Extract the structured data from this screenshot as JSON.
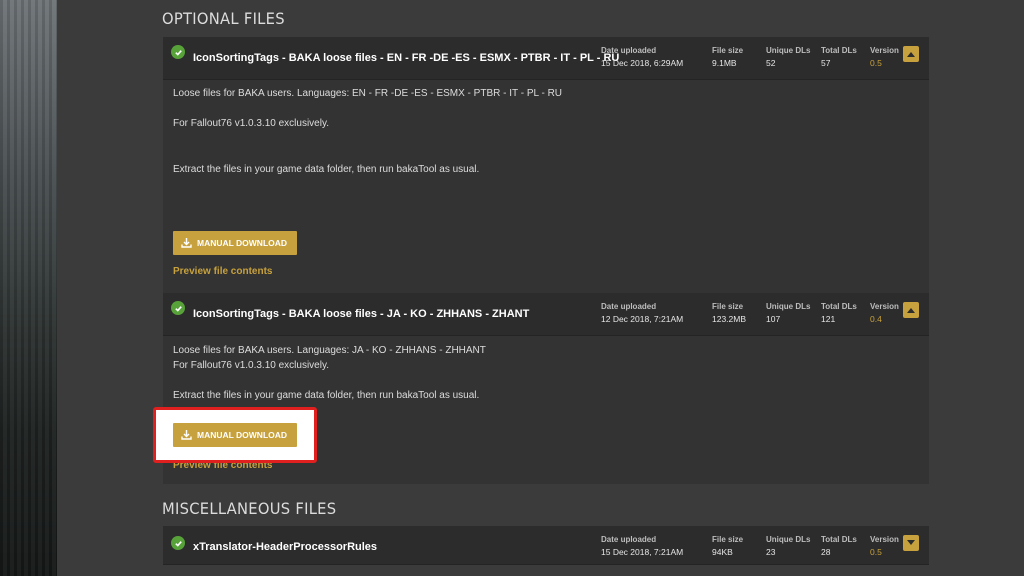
{
  "sections": {
    "optional_title": "OPTIONAL FILES",
    "misc_title": "MISCELLANEOUS FILES"
  },
  "meta_labels": {
    "date": "Date uploaded",
    "size": "File size",
    "unique": "Unique DLs",
    "total": "Total DLs",
    "version": "Version"
  },
  "files": [
    {
      "name": "IconSortingTags - BAKA loose files - EN - FR -DE -ES - ESMX - PTBR - IT - PL - RU",
      "date": "15 Dec 2018, 6:29AM",
      "size": "9.1MB",
      "unique": "52",
      "total": "57",
      "version": "0.5",
      "desc1": "Loose files for BAKA users. Languages: EN - FR -DE -ES - ESMX - PTBR - IT - PL - RU",
      "desc2": "For Fallout76 v1.0.3.10 exclusively.",
      "desc3": "Extract the files in your game data folder, then run bakaTool as usual.",
      "download_label": "MANUAL DOWNLOAD",
      "preview_label": "Preview file contents"
    },
    {
      "name": "IconSortingTags - BAKA loose files - JA - KO - ZHHANS - ZHANT",
      "date": "12 Dec 2018, 7:21AM",
      "size": "123.2MB",
      "unique": "107",
      "total": "121",
      "version": "0.4",
      "desc1": "Loose files for BAKA users. Languages: JA - KO - ZHHANS - ZHHANT",
      "desc2": "For Fallout76 v1.0.3.10 exclusively.",
      "desc3": "Extract the files in your game data folder, then run bakaTool as usual.",
      "download_label": "MANUAL DOWNLOAD",
      "preview_label": "Preview file contents"
    },
    {
      "name": "xTranslator-HeaderProcessorRules",
      "date": "15 Dec 2018, 7:21AM",
      "size": "94KB",
      "unique": "23",
      "total": "28",
      "version": "0.5"
    }
  ],
  "colors": {
    "accent": "#c7a13d",
    "highlight": "#e01f1f",
    "check": "#58a23a"
  }
}
